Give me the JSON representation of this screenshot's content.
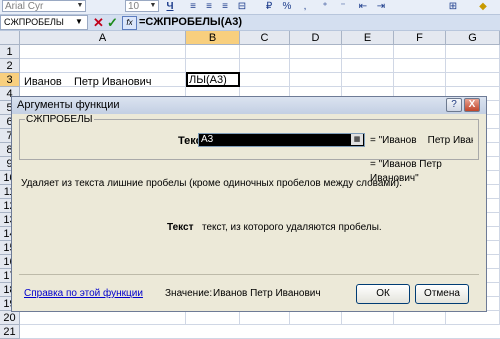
{
  "toolbar": {
    "font_name": "Arial Cyr",
    "font_size": "10",
    "icons": [
      "underline-icon",
      "align-left-icon",
      "align-center-icon",
      "align-right-icon",
      "merge-icon",
      "currency-icon",
      "percent-icon",
      "thousands-icon",
      "decrease-indent-icon",
      "increase-indent-icon",
      "borders-icon",
      "fill-color-icon"
    ]
  },
  "formula_bar": {
    "name_box": "СЖПРОБЕЛЫ",
    "formula": "=СЖПРОБЕЛЫ(A3)"
  },
  "sheet": {
    "columns": [
      "A",
      "B",
      "C",
      "D",
      "E",
      "F",
      "G"
    ],
    "selected_column": "B",
    "rows": [
      "1",
      "2",
      "3",
      "4",
      "5",
      "6",
      "7",
      "8",
      "9",
      "10",
      "11",
      "12",
      "13",
      "14",
      "15",
      "16",
      "17",
      "18",
      "19",
      "20",
      "21"
    ],
    "selected_row": "3",
    "cell_a3": "Иванов    Петр Иванович",
    "cell_b3": "ЛЫ(A3)"
  },
  "dialog": {
    "title": "Аргументы функции",
    "help_glyph": "?",
    "close_glyph": "X",
    "function_name": "СЖПРОБЕЛЫ",
    "arg_label": "Текст",
    "arg_value": "A3",
    "arg_result": "= \"Иванов    Петр Иван",
    "formula_result": "= \"Иванов Петр Иванович\"",
    "function_description": "Удаляет из текста лишние пробелы (кроме одиночных пробелов между словами).",
    "arg_desc_name": "Текст",
    "arg_desc_text": "текст, из которого удаляются пробелы.",
    "help_link": "Справка по этой функции",
    "value_label": "Значение:",
    "value_text": "Иванов Петр Иванович",
    "ok_label": "ОК",
    "cancel_label": "Отмена"
  },
  "colors": {
    "selection_header": "#f8cf7e",
    "dialog_background": "#ece9d8",
    "link": "#0000cc"
  }
}
